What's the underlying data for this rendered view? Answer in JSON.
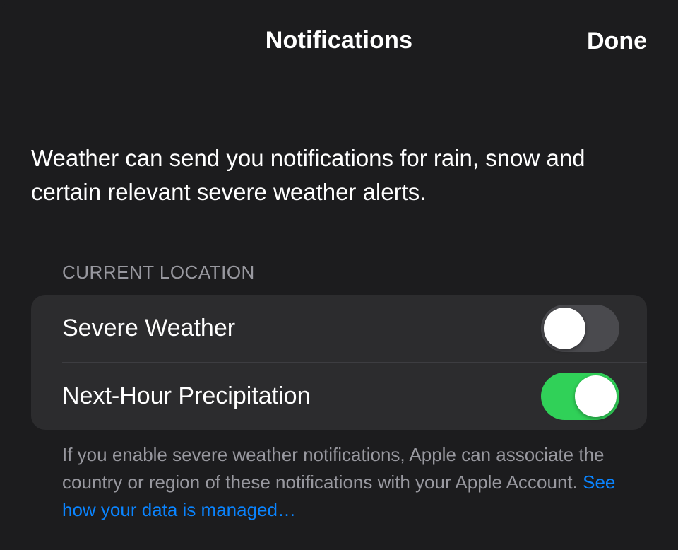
{
  "nav": {
    "title": "Notifications",
    "done_label": "Done"
  },
  "intro": {
    "text": "Weather can send you notifications for rain, snow and certain relevant severe weather alerts."
  },
  "section": {
    "header": "CURRENT LOCATION",
    "rows": [
      {
        "label": "Severe Weather",
        "enabled": false
      },
      {
        "label": "Next-Hour Precipitation",
        "enabled": true
      }
    ]
  },
  "footer": {
    "text": "If you enable severe weather notifications, Apple can associate the country or region of these notifications with your Apple Account.",
    "link_label": "See how your data is managed…"
  },
  "colors": {
    "background": "#1c1c1e",
    "group_background": "#2c2c2e",
    "toggle_on": "#30d158",
    "toggle_off": "#4a4a4e",
    "link": "#0a84ff",
    "secondary_text": "#98989f"
  }
}
